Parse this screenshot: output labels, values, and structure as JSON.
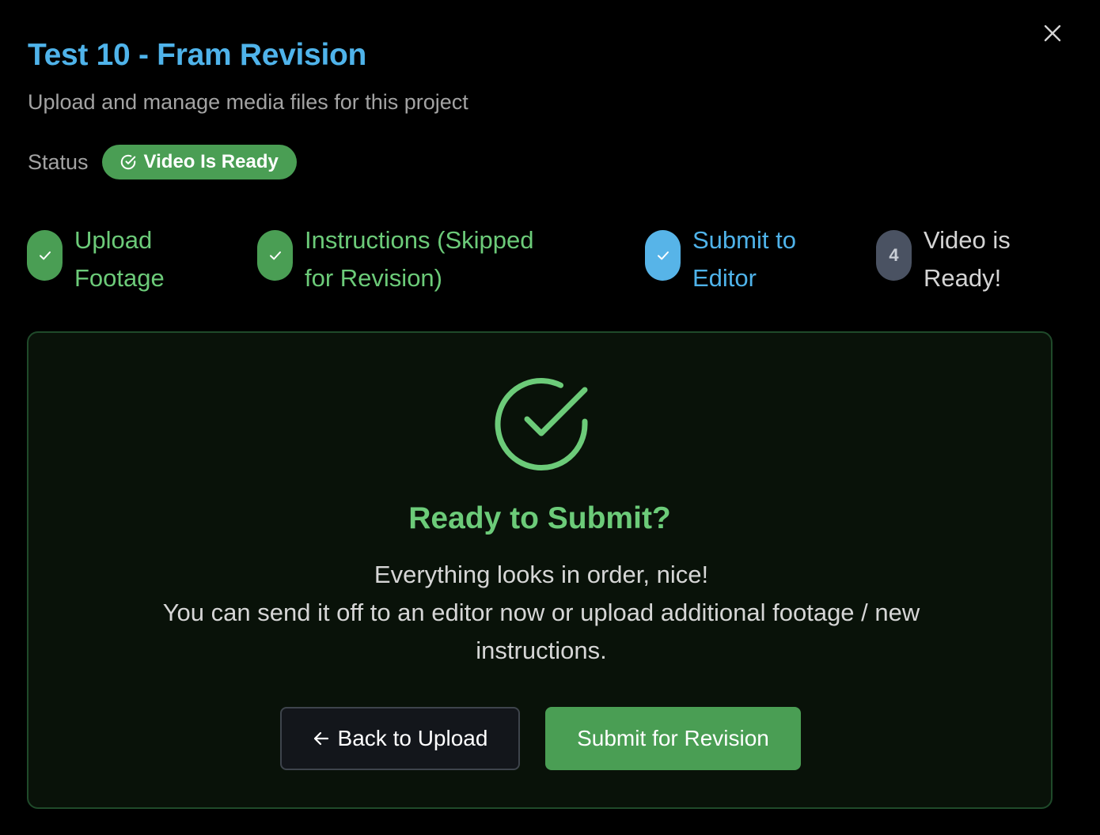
{
  "header": {
    "title": "Test 10 - Fram Revision",
    "subtitle": "Upload and manage media files for this project",
    "status_label": "Status",
    "status_badge": "Video Is Ready",
    "close_icon": "close-icon"
  },
  "steps": [
    {
      "label": "Upload\nFootage",
      "state": "done",
      "icon": "check-icon"
    },
    {
      "label": "Instructions (Skipped\nfor Revision)",
      "state": "done",
      "icon": "check-icon"
    },
    {
      "label": "Submit to\nEditor",
      "state": "active",
      "icon": "check-icon"
    },
    {
      "label": "Video is\nReady!",
      "state": "pending",
      "number": "4"
    }
  ],
  "panel": {
    "icon": "check-circle-icon",
    "title": "Ready to Submit?",
    "line1": "Everything looks in order, nice!",
    "line2": "You can send it off to an editor now or upload additional footage / new instructions.",
    "back_label": "Back to Upload",
    "back_icon": "arrow-left-icon",
    "submit_label": "Submit for Revision"
  },
  "colors": {
    "accent_blue": "#4fb3ea",
    "success_green": "#4a9e54",
    "success_text": "#6ccb79",
    "pending_gray": "#4a5262"
  }
}
